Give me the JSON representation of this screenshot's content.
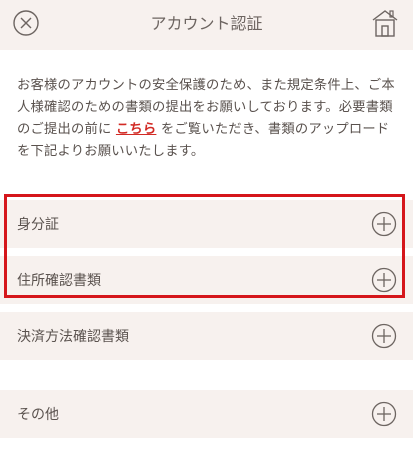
{
  "header": {
    "title": "アカウント認証",
    "close_icon": "close-icon",
    "home_icon": "home-icon"
  },
  "intro": {
    "text_before": "お客様のアカウントの安全保護のため、また規定条件上、ご本人様確認のための書類の提出をお願いしております。必要書類のご提出の前に ",
    "link": "こちら",
    "text_after": " をご覧いただき、書類のアップロードを下記よりお願いいたします。"
  },
  "sections": [
    {
      "label": "身分証",
      "icon": "plus-circle-icon"
    },
    {
      "label": "住所確認書類",
      "icon": "plus-circle-icon"
    },
    {
      "label": "決済方法確認書類",
      "icon": "plus-circle-icon"
    },
    {
      "label": "その他",
      "icon": "plus-circle-icon"
    }
  ],
  "colors": {
    "background": "#f7f1ee",
    "highlight": "#d5161b",
    "link": "#d22a24",
    "text": "#5a524e"
  }
}
